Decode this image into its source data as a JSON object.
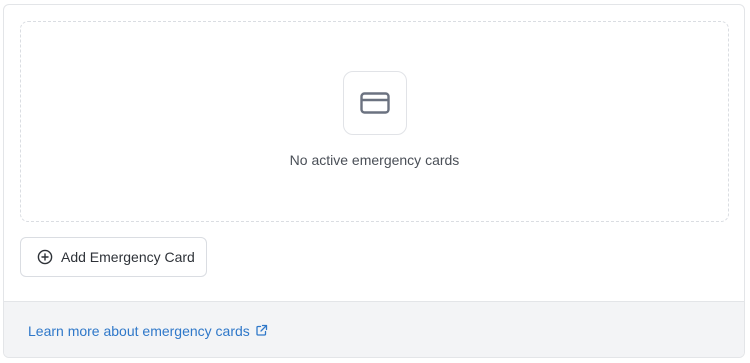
{
  "empty_state": {
    "icon": "credit-card-icon",
    "message": "No active emergency cards"
  },
  "actions": {
    "add_label": "Add Emergency Card",
    "add_icon": "plus-circle-icon"
  },
  "footer": {
    "link_text": "Learn more about emergency cards",
    "link_icon": "external-link-icon"
  },
  "colors": {
    "link": "#2f78c9",
    "icon": "#6b7280",
    "footer_bg": "#f3f4f6"
  }
}
